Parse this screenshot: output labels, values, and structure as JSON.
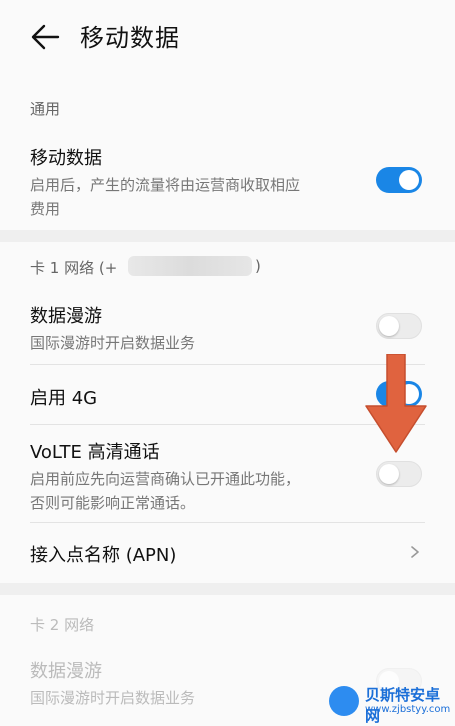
{
  "header": {
    "title": "移动数据",
    "back_icon": "arrow-left-icon"
  },
  "general": {
    "section": "通用",
    "mobile_data": {
      "title": "移动数据",
      "sub_line1": "启用后，产生的流量将由运营商收取相应",
      "sub_line2": "费用",
      "enabled": true
    }
  },
  "sim1": {
    "section": "卡 1 网络 (+",
    "section_tail": ")",
    "roaming": {
      "title": "数据漫游",
      "sub": "国际漫游时开启数据业务",
      "enabled": false
    },
    "use4g": {
      "title": "启用 4G",
      "enabled": true
    },
    "volte": {
      "title": "VoLTE 高清通话",
      "sub_line1": "启用前应先向运营商确认已开通此功能，",
      "sub_line2": "否则可能影响正常通话。",
      "enabled": false
    },
    "apn": {
      "title": "接入点名称 (APN)"
    }
  },
  "sim2": {
    "section": "卡 2 网络",
    "roaming": {
      "title": "数据漫游",
      "sub": "国际漫游时开启数据业务",
      "enabled": false
    }
  },
  "watermark": {
    "title": "贝斯特安卓网",
    "url": "www.zjbstyy.com"
  },
  "colors": {
    "accent": "#1a86e6",
    "arrow": "#e0633f"
  }
}
